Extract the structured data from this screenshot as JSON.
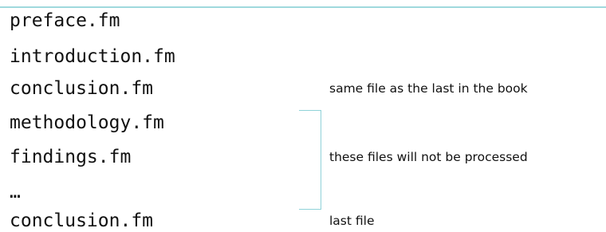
{
  "files": [
    "preface.fm",
    "introduction.fm",
    "conclusion.fm",
    "methodology.fm",
    "findings.fm",
    "…",
    "conclusion.fm"
  ],
  "notes": {
    "same_file": "same file as the last in the book",
    "not_processed": "these files will not be processed",
    "last_file": "last file"
  }
}
